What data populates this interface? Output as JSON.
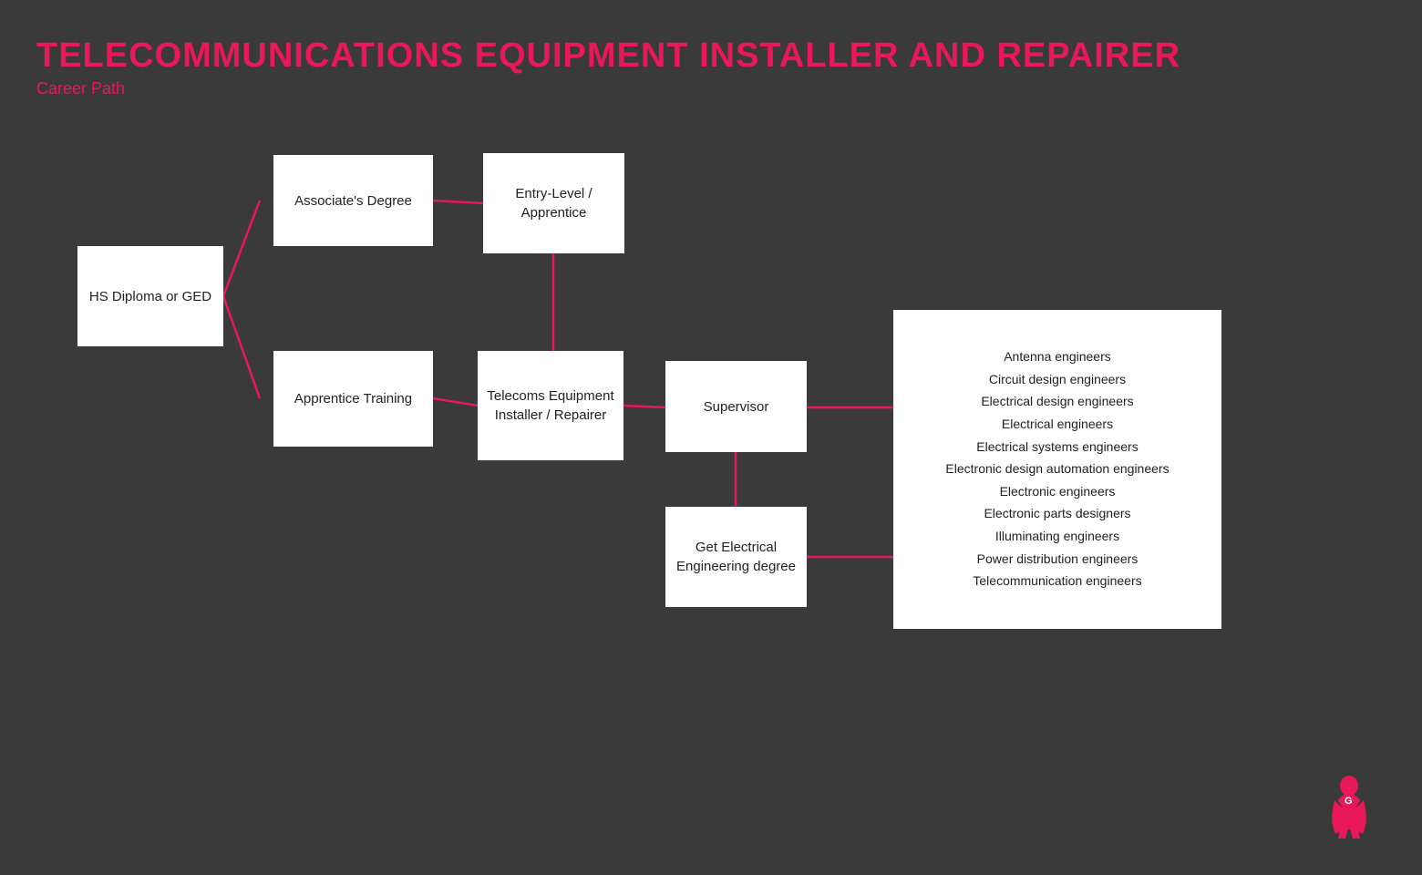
{
  "header": {
    "main_title": "TELECOMMUNICATIONS EQUIPMENT  INSTALLER AND REPAIRER",
    "sub_title": "Career Path"
  },
  "boxes": {
    "hs": "HS Diploma or GED",
    "assoc": "Associate's Degree",
    "apprentice": "Apprentice Training",
    "entry": "Entry-Level / Apprentice",
    "telecoms": "Telecoms Equipment Installer / Repairer",
    "supervisor": "Supervisor",
    "degree": "Get Electrical Engineering degree"
  },
  "related_jobs": [
    "Antenna engineers",
    "Circuit design engineers",
    "Electrical design engineers",
    "Electrical engineers",
    "Electrical systems engineers",
    "Electronic design automation engineers",
    "Electronic engineers",
    "Electronic parts designers",
    "Illuminating engineers",
    "Power distribution engineers",
    "Telecommunication engineers"
  ],
  "accent_color": "#e8185a"
}
